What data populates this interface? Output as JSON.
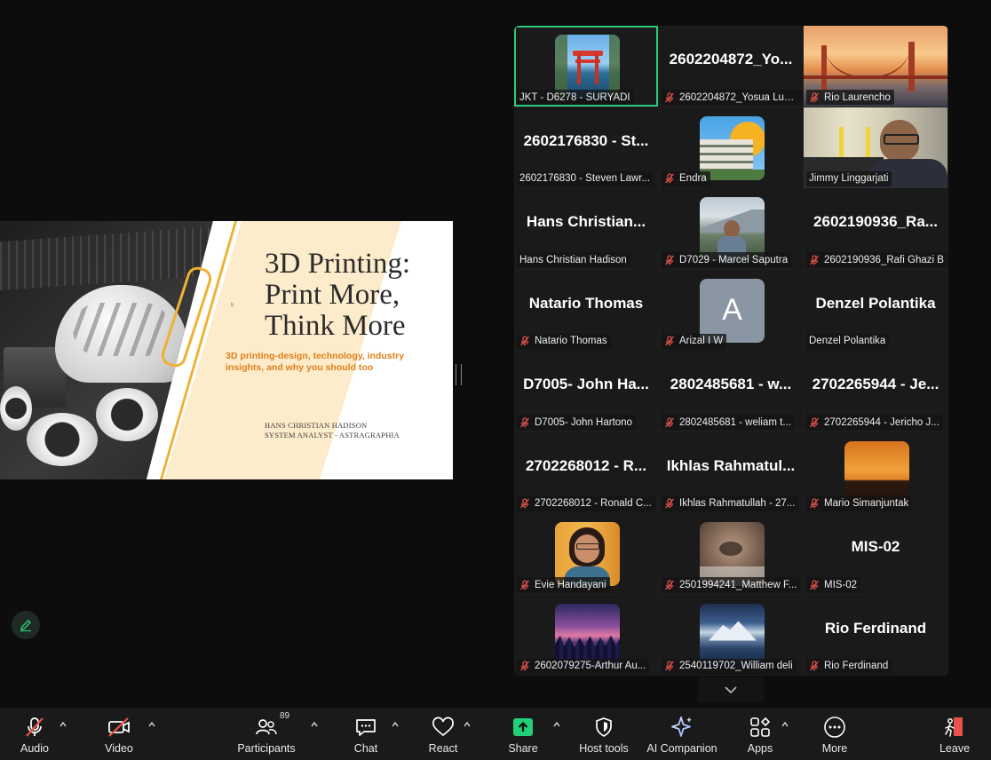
{
  "slide": {
    "title_lines": [
      "3D Printing:",
      "Print More,",
      "Think More"
    ],
    "subtitle": "3D printing-design, technology, industry insights, and why you should too",
    "author_name": "HANS CHRISTIAN HADISON",
    "author_role": "SYSTEM ANALYST - ASTRAGRAPHIA",
    "mark": "b"
  },
  "participants": [
    {
      "big": "",
      "label": "JKT - D6278 - SURYADI",
      "muted": false,
      "pic": "torii-gate"
    },
    {
      "big": "2602204872_Yo...",
      "label": "2602204872_Yosua Lum...",
      "muted": true,
      "pic": ""
    },
    {
      "big": "",
      "label": "Rio Laurencho",
      "muted": true,
      "pic": "golden-gate"
    },
    {
      "big": "2602176830 - St...",
      "label": "2602176830 - Steven Lawr...",
      "muted": false,
      "pic": ""
    },
    {
      "big": "",
      "label": "Endra",
      "muted": true,
      "pic": "building"
    },
    {
      "big": "",
      "label": "Jimmy Linggarjati",
      "muted": false,
      "pic": "webcam"
    },
    {
      "big": "Hans Christian...",
      "label": "Hans Christian Hadison",
      "muted": false,
      "pic": ""
    },
    {
      "big": "",
      "label": "D7029 - Marcel Saputra",
      "muted": true,
      "pic": "mountain-man"
    },
    {
      "big": "2602190936_Ra...",
      "label": "2602190936_Rafi Ghazi B",
      "muted": true,
      "pic": ""
    },
    {
      "big": "Natario Thomas",
      "label": "Natario Thomas",
      "muted": true,
      "pic": ""
    },
    {
      "big": "",
      "label": "Arizal I W",
      "muted": true,
      "pic": "letter",
      "letter": "A"
    },
    {
      "big": "Denzel Polantika",
      "label": "Denzel Polantika",
      "muted": false,
      "pic": ""
    },
    {
      "big": "D7005- John Ha...",
      "label": "D7005- John Hartono",
      "muted": true,
      "pic": ""
    },
    {
      "big": "2802485681 - w...",
      "label": "2802485681 - weliam t...",
      "muted": true,
      "pic": ""
    },
    {
      "big": "2702265944 - Je...",
      "label": "2702265944 - Jericho J...",
      "muted": true,
      "pic": ""
    },
    {
      "big": "2702268012 - R...",
      "label": "2702268012 - Ronald C...",
      "muted": true,
      "pic": ""
    },
    {
      "big": "Ikhlas Rahmatul...",
      "label": "Ikhlas Rahmatullah - 27...",
      "muted": true,
      "pic": ""
    },
    {
      "big": "",
      "label": "Mario Simanjuntak",
      "muted": true,
      "pic": "sunset"
    },
    {
      "big": "",
      "label": "Evie Handayani",
      "muted": true,
      "pic": "woman"
    },
    {
      "big": "",
      "label": "2501994241_Matthew F...",
      "muted": true,
      "pic": "blur"
    },
    {
      "big": "MIS-02",
      "label": "MIS-02",
      "muted": true,
      "pic": ""
    },
    {
      "big": "",
      "label": "2602079275-Arthur Au...",
      "muted": true,
      "pic": "night-forest"
    },
    {
      "big": "",
      "label": "2540119702_William deli",
      "muted": true,
      "pic": "lake-mountain"
    },
    {
      "big": "Rio Ferdinand",
      "label": "Rio Ferdinand",
      "muted": true,
      "pic": ""
    }
  ],
  "toolbar": {
    "audio": "Audio",
    "video": "Video",
    "participants": "Participants",
    "participants_count": "89",
    "chat": "Chat",
    "react": "React",
    "share": "Share",
    "host_tools": "Host tools",
    "ai_companion": "AI Companion",
    "apps": "Apps",
    "more": "More",
    "leave": "Leave"
  },
  "colors": {
    "active_speaker": "#2dcb7a",
    "mute_red": "#e5534b",
    "share_green": "#23d07a",
    "leave_red": "#e5534b"
  }
}
